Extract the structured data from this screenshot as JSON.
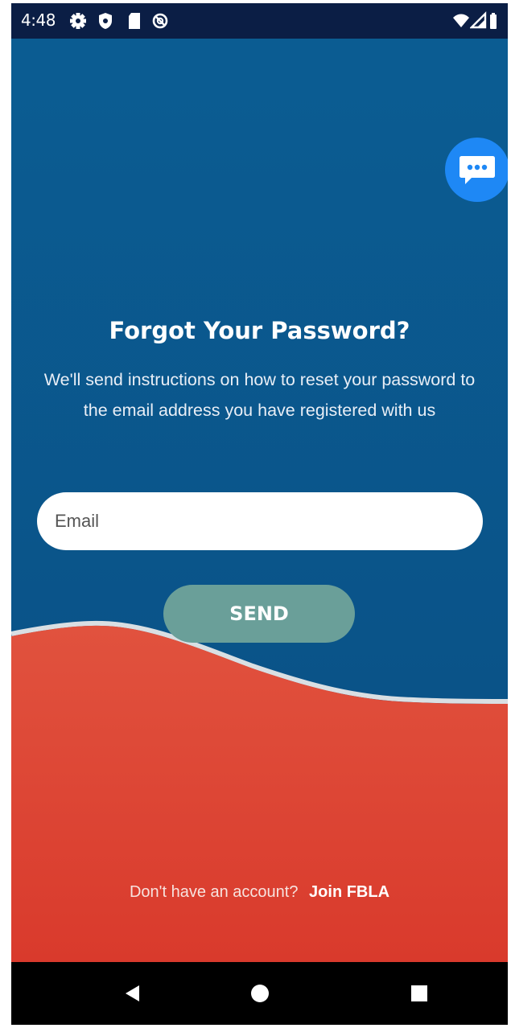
{
  "status_bar": {
    "time": "4:48",
    "left_icons": [
      "settings-icon",
      "shield-icon",
      "sd-card-icon",
      "no-sync-icon"
    ],
    "right_icons": [
      "wifi-icon",
      "signal-icon",
      "battery-icon"
    ]
  },
  "chat_fab": {
    "icon": "chat-bubble-icon",
    "color": "#1e88f5"
  },
  "forgot_password": {
    "title": "Forgot Your Password?",
    "description": "We'll send instructions on how to reset your password to the email address you have registered with us",
    "email_placeholder": "Email",
    "email_value": "",
    "send_label": "SEND"
  },
  "footer": {
    "prompt": "Don't have an account?",
    "link_label": "Join FBLA"
  },
  "nav_bar": {
    "buttons": [
      "back-icon",
      "home-icon",
      "recents-icon"
    ]
  },
  "colors": {
    "background_blue": "#0c5b92",
    "status_bar": "#0b1e45",
    "wave_red": "#df4433",
    "send_button": "#6a9f99",
    "chat_fab": "#1e88f5"
  }
}
